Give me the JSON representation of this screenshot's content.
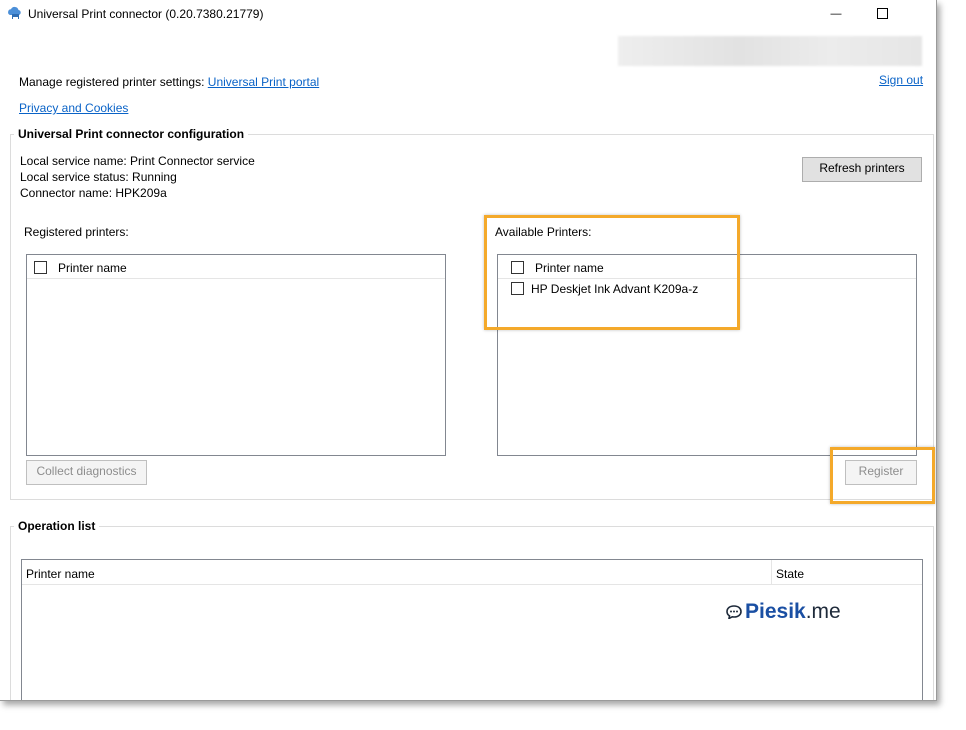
{
  "window": {
    "title": "Universal Print connector (0.20.7380.21779)",
    "minimize_glyph": "—",
    "maximize_glyph": "☐"
  },
  "header": {
    "manage_text": "Manage registered printer settings:",
    "portal_link": "Universal Print portal",
    "privacy_link": "Privacy and Cookies",
    "sign_out": "Sign out"
  },
  "config": {
    "group_title": "Universal Print connector configuration",
    "service_name": "Local service name: Print Connector service",
    "service_status": "Local service status: Running",
    "connector_name": "Connector name: HPK209a",
    "refresh_button": "Refresh printers"
  },
  "registered": {
    "label": "Registered printers:",
    "column": "Printer name",
    "items": [],
    "collect_button": "Collect diagnostics"
  },
  "available": {
    "label": "Available Printers:",
    "column": "Printer name",
    "items": [
      "HP Deskjet Ink Advant K209a-z"
    ],
    "register_button": "Register"
  },
  "operations": {
    "group_title": "Operation list",
    "columns": [
      "Printer name",
      "State"
    ]
  },
  "watermark": {
    "brand": "Piesik",
    "tld": ".me"
  },
  "colors": {
    "highlight": "#f4a92a",
    "link": "#0a63c7"
  }
}
